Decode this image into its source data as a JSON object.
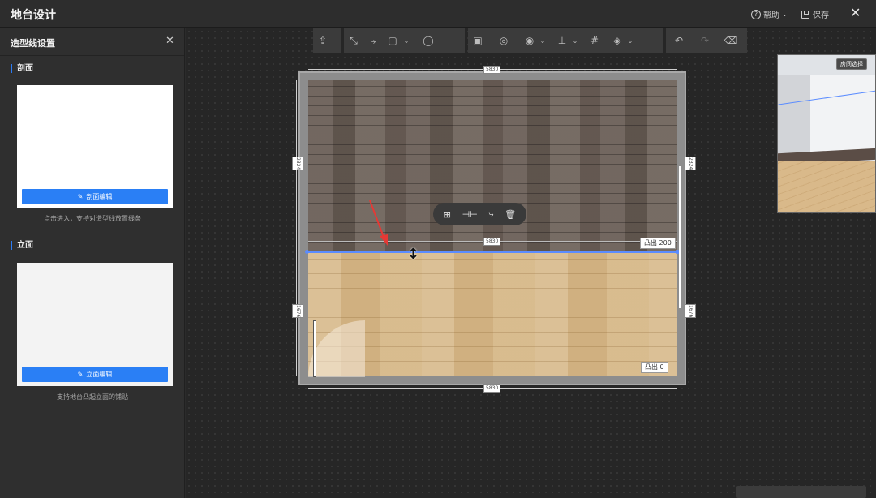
{
  "app": {
    "title": "地台设计"
  },
  "header": {
    "help_label": "帮助",
    "save_label": "保存"
  },
  "sidebar": {
    "title": "造型线设置",
    "section_profile": {
      "label": "剖面",
      "button": "剖面编辑",
      "hint": "点击进入，支持对造型线放置线条"
    },
    "section_elevation": {
      "label": "立面",
      "button": "立面编辑",
      "hint": "支持地台凸起立面的铺贴"
    }
  },
  "canvas": {
    "dimension_top": "5830",
    "dimension_middle": "5830",
    "dimension_bottom": "5830",
    "dimension_left_upper": "2324",
    "dimension_right_upper": "2324",
    "dimension_left_lower": "1676",
    "dimension_right_lower": "1676",
    "bump_top": "凸出 200",
    "bump_bottom": "凸出 0",
    "preview_button": "房间选择"
  },
  "colors": {
    "accent": "#2a7ff5",
    "selection": "#5b8cff",
    "arrow": "#e53935"
  }
}
